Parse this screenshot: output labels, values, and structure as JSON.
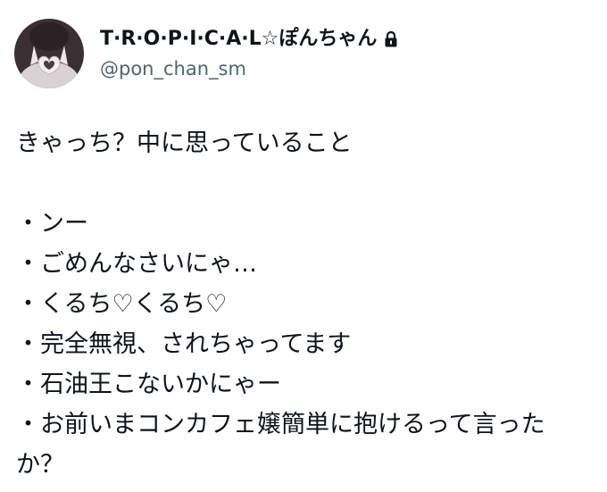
{
  "user": {
    "display_name": "T·R·O·P·I·C·A·L☆ぽんちゃん",
    "handle": "@pon_chan_sm",
    "protected_icon": "lock-icon"
  },
  "tweet": {
    "title": "きゃっち？中に思っていること",
    "items": [
      "・ンー",
      "・ごめんなさいにゃ…",
      "・くるち♡くるち♡",
      "・完全無視、されちゃってます",
      "・石油王こないかにゃー",
      "・お前いまコンカフェ嬢簡単に抱けるって言ったか？"
    ]
  },
  "colors": {
    "text": "#0f1419",
    "secondary_text": "#536471"
  }
}
